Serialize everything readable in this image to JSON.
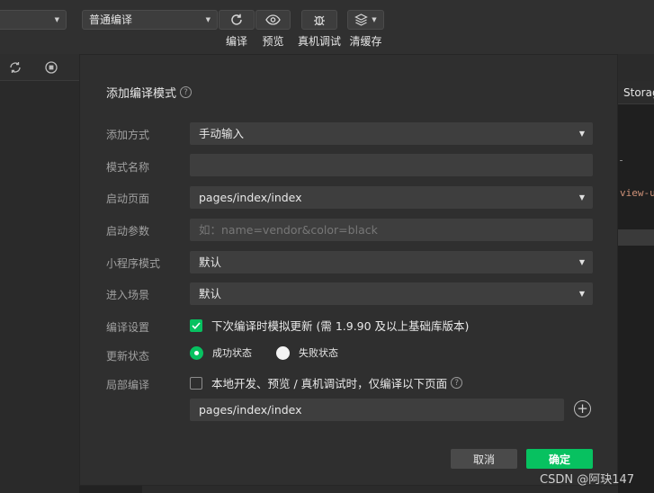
{
  "toolbar": {
    "mode_select": "普通编译",
    "compile_label": "编译",
    "preview_label": "预览",
    "remote_debug_label": "真机调试",
    "clear_cache_label": "清缓存"
  },
  "editor": {
    "tab_label": "Storag",
    "code_fragment": "view-u"
  },
  "dialog": {
    "title": "添加编译模式",
    "add_method_label": "添加方式",
    "add_method_value": "手动输入",
    "mode_name_label": "模式名称",
    "mode_name_value": "",
    "launch_page_label": "启动页面",
    "launch_page_value": "pages/index/index",
    "launch_params_label": "启动参数",
    "launch_params_placeholder": "如：name=vendor&color=black",
    "mini_mode_label": "小程序模式",
    "mini_mode_value": "默认",
    "scene_label": "进入场景",
    "scene_value": "默认",
    "compile_settings_label": "编译设置",
    "simulate_update_text": "下次编译时模拟更新 (需 1.9.90 及以上基础库版本)",
    "simulate_update_checked": true,
    "update_status_label": "更新状态",
    "status_success": "成功状态",
    "status_fail": "失败状态",
    "selected_status": "成功状态",
    "partial_compile_label": "局部编译",
    "partial_compile_text": "本地开发、预览 / 真机调试时，仅编译以下页面",
    "partial_compile_checked": false,
    "partial_page_value": "pages/index/index",
    "cancel_label": "取消",
    "confirm_label": "确定"
  },
  "watermark": "CSDN @阿玦147",
  "colors": {
    "accent": "#07c160",
    "dialog_bg": "#2f2f2f",
    "field_bg": "#3e3e3e"
  }
}
